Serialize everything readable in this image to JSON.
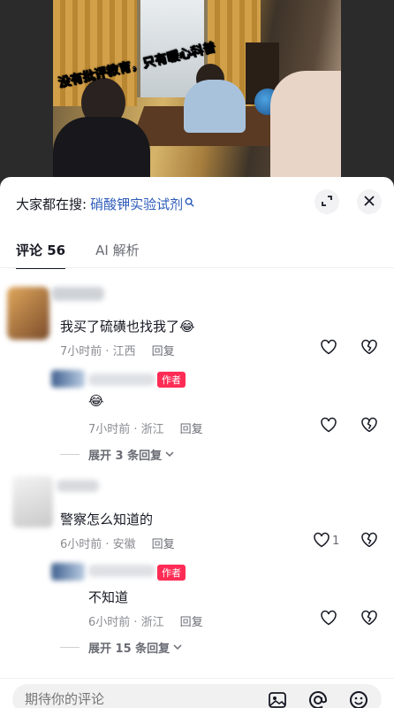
{
  "video": {
    "overlay_text": "没有批评教育，只有暖心科普"
  },
  "search": {
    "label": "大家都在搜:",
    "term": "硝酸钾实验试剂"
  },
  "tabs": [
    {
      "label": "评论 56"
    },
    {
      "label": "AI 解析"
    }
  ],
  "comments": [
    {
      "text": "我买了硫磺也找我了😂",
      "time": "7小时前 · 江西",
      "reply_label": "回复",
      "reply": {
        "badge": "作者",
        "text": "😂",
        "time": "7小时前 · 浙江",
        "reply_label": "回复"
      },
      "expand_label": "展开 3 条回复"
    },
    {
      "text": "警察怎么知道的",
      "time": "6小时前 · 安徽",
      "reply_label": "回复",
      "like_count": "1",
      "reply": {
        "badge": "作者",
        "text": "不知道",
        "time": "6小时前 · 浙江",
        "reply_label": "回复"
      },
      "expand_label": "展开 15 条回复"
    }
  ],
  "composer": {
    "placeholder": "期待你的评论"
  },
  "colors": {
    "accent_red": "#fe2c55",
    "link_blue": "#2d5bb9"
  }
}
